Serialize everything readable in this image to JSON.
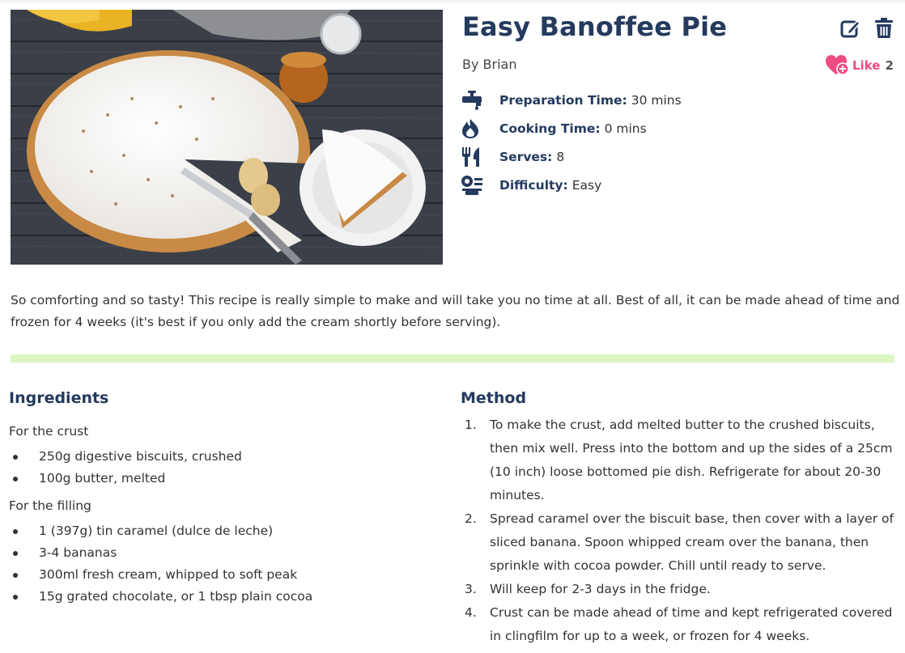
{
  "recipe": {
    "title": "Easy Banoffee Pie",
    "author": "By Brian",
    "like_label": "Like",
    "like_count": "2",
    "meta": [
      {
        "icon": "tap-icon",
        "label": "Preparation Time:",
        "value": "30 mins"
      },
      {
        "icon": "flame-icon",
        "label": "Cooking Time:",
        "value": "0 mins"
      },
      {
        "icon": "utensils-icon",
        "label": "Serves:",
        "value": "8"
      },
      {
        "icon": "difficulty-icon",
        "label": "Difficulty:",
        "value": "Easy"
      }
    ],
    "description": "So comforting and so tasty! This recipe is really simple to make and will take you no time at all. Best of all, it can be made ahead of time and frozen for 4 weeks (it's best if you only add the cream shortly before serving).",
    "ingredients_heading": "Ingredients",
    "method_heading": "Method",
    "ingredient_groups": [
      {
        "title": "For the crust",
        "items": [
          "250g digestive biscuits, crushed",
          "100g butter, melted"
        ]
      },
      {
        "title": "For the filling",
        "items": [
          "1 (397g) tin caramel (dulce de leche)",
          "3-4 bananas",
          "300ml fresh cream, whipped to soft peak",
          "15g grated chocolate, or 1 tbsp plain cocoa"
        ]
      }
    ],
    "method": [
      {
        "num": "1.",
        "text": "To make the crust, add melted butter to the crushed biscuits, then mix well. Press into the bottom and up the sides of a 25cm (10 inch) loose bottomed pie dish. Refrigerate for about 20-30 minutes."
      },
      {
        "num": "2.",
        "text": "Spread caramel over the biscuit base, then cover with a layer of sliced banana. Spoon whipped cream over the banana, then sprinkle with cocoa powder. Chill until ready to serve."
      },
      {
        "num": "3.",
        "text": "Will keep for 2-3 days in the fridge."
      },
      {
        "num": "4.",
        "text": "Crust can be made ahead of time and kept refrigerated covered in clingfilm for up to a week, or frozen for 4 weeks."
      }
    ]
  },
  "colors": {
    "heading": "#243a5e",
    "like": "#ee4d82",
    "divider": "#dcf7c4"
  }
}
